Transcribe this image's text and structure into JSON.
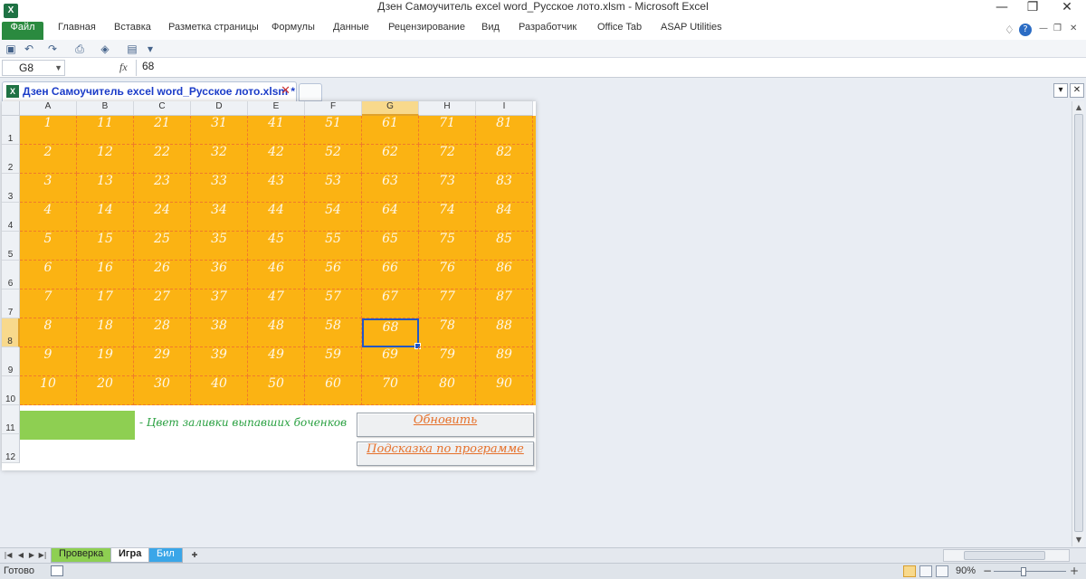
{
  "window": {
    "title": "Дзен Самоучитель excel word_Русское лото.xlsm  -  Microsoft Excel",
    "app_icon": "excel-icon",
    "minimize": "—",
    "restore": "❐",
    "close": "✕"
  },
  "ribbon": {
    "file_tab": "Файл",
    "tabs": [
      "Главная",
      "Вставка",
      "Разметка страницы",
      "Формулы",
      "Данные",
      "Рецензирование",
      "Вид",
      "Разработчик",
      "Office Tab",
      "ASAP Utilities"
    ]
  },
  "formula_bar": {
    "name_box": "G8",
    "fx": "fx",
    "value": "68"
  },
  "document_tab": {
    "label": "Дзен Самоучитель excel word_Русское лото.xlsm *",
    "close": "✕"
  },
  "sheet": {
    "columns": [
      "A",
      "B",
      "C",
      "D",
      "E",
      "F",
      "G",
      "H",
      "I"
    ],
    "rows": [
      "1",
      "2",
      "3",
      "4",
      "5",
      "6",
      "7",
      "8",
      "9",
      "10",
      "11",
      "12"
    ],
    "selected_column": "G",
    "selected_row": "8",
    "grid": [
      [
        "1",
        "11",
        "21",
        "31",
        "41",
        "51",
        "61",
        "71",
        "81"
      ],
      [
        "2",
        "12",
        "22",
        "32",
        "42",
        "52",
        "62",
        "72",
        "82"
      ],
      [
        "3",
        "13",
        "23",
        "33",
        "43",
        "53",
        "63",
        "73",
        "83"
      ],
      [
        "4",
        "14",
        "24",
        "34",
        "44",
        "54",
        "64",
        "74",
        "84"
      ],
      [
        "5",
        "15",
        "25",
        "35",
        "45",
        "55",
        "65",
        "75",
        "85"
      ],
      [
        "6",
        "16",
        "26",
        "36",
        "46",
        "56",
        "66",
        "76",
        "86"
      ],
      [
        "7",
        "17",
        "27",
        "37",
        "47",
        "57",
        "67",
        "77",
        "87"
      ],
      [
        "8",
        "18",
        "28",
        "38",
        "48",
        "58",
        "68",
        "78",
        "88"
      ],
      [
        "9",
        "19",
        "29",
        "39",
        "49",
        "59",
        "69",
        "79",
        "89"
      ],
      [
        "10",
        "20",
        "30",
        "40",
        "50",
        "60",
        "70",
        "80",
        "90"
      ]
    ],
    "legend_text": "- Цвет заливки выпавших боченков",
    "refresh_button": "Обновить",
    "help_button": "Подсказка по программе"
  },
  "colors": {
    "grid_fill": "#fbb313",
    "dropped_fill": "#8ecf52",
    "button_text": "#e6702a",
    "legend_text": "#29a040"
  },
  "sheet_tabs": [
    {
      "label": "Проверка",
      "color": "#8ecf52"
    },
    {
      "label": "Игра",
      "color": "#ffffff"
    },
    {
      "label": "Бил",
      "color": "#3aa6e8"
    }
  ],
  "status": {
    "ready": "Готово",
    "zoom": "90%"
  }
}
